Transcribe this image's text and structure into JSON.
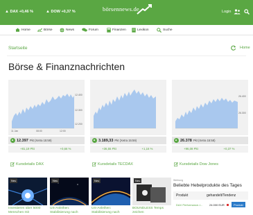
{
  "header": {
    "indices": [
      {
        "label": "DAX +0,46 %"
      },
      {
        "label": "DOW +0,37 %"
      }
    ],
    "logo": "börsennews.de",
    "login_label": "Login",
    "brand_color": "#5aa743"
  },
  "nav": [
    {
      "label": "Home",
      "icon": "home-icon"
    },
    {
      "label": "Börse",
      "icon": "chart-icon"
    },
    {
      "label": "News",
      "icon": "globe-icon"
    },
    {
      "label": "Forum",
      "icon": "chat-icon"
    },
    {
      "label": "Finanzen",
      "icon": "calculator-icon"
    },
    {
      "label": "Lexikon",
      "icon": "book-icon"
    },
    {
      "label": "Suche",
      "icon": "search-icon"
    }
  ],
  "page": {
    "breadcrumb": "Startseite",
    "home_link": "Home",
    "title": "Börse & Finanznachrichten"
  },
  "cards": [
    {
      "value": "12.397",
      "unit": "Pkt (Xetra 15:59)",
      "perf": [
        "+81,19 Pkt",
        "+0,66 %"
      ],
      "detail": "Kursdetails DAX",
      "x_ticks": [
        "11 Jan",
        "08:00",
        "12:00"
      ],
      "y_ticks": [
        "12.400",
        "12.300",
        "12.200"
      ]
    },
    {
      "value": "3.189,33",
      "unit": "Pkt (Xetra 15:59)",
      "perf": [
        "+36,55 Pkt",
        "+1,16 %"
      ],
      "detail": "Kursdetails TECDAX",
      "x_ticks": [],
      "y_ticks": []
    },
    {
      "value": "26.378",
      "unit": "Pkt (Xetra 15:58)",
      "perf": [
        "+96,08 Pkt",
        "+0,37 %"
      ],
      "detail": "Kursdetails Dow Jones",
      "x_ticks": [],
      "y_ticks": [
        "26.400",
        "26.300"
      ]
    }
  ],
  "news": [
    {
      "badge": "Neu",
      "title": "Investieren über 5000 Menschen mit"
    },
    {
      "badge": "Neu",
      "title": "US-Anleihen: Stabilisierung nach"
    },
    {
      "badge": "Neu",
      "title": "US-Anleihen: Stabilisierung nach"
    },
    {
      "badge": "Neu",
      "title": "BOUNDLESS Temps zeichen"
    }
  ],
  "sidebar": {
    "tiny": "Werbung",
    "title": "Beliebte Hebelprodukte des Tages",
    "col1": "Produkt",
    "col2": "gehandelt/Tendenz",
    "row": {
      "name": "DAX Performance-I...",
      "price": "24.000 EUR",
      "button": "Produkt"
    }
  }
}
